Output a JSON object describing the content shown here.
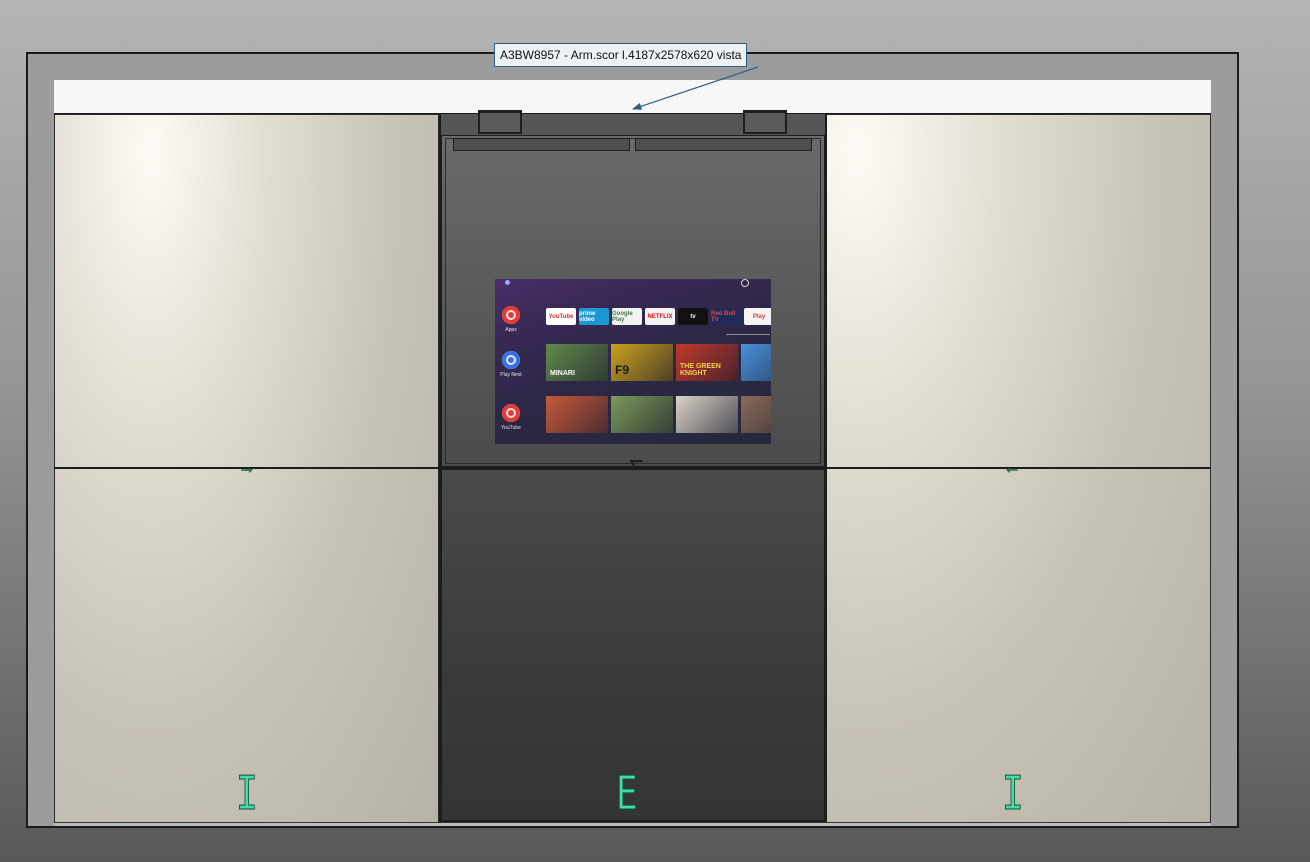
{
  "label": {
    "text": "A3BW8957 - Arm.scor  l.4187x2578x620 vista"
  },
  "openings": {
    "left_door": "I",
    "center_door": "E",
    "right_door": "I"
  },
  "arrows": {
    "left_door": "→",
    "right_door": "←"
  },
  "tv_screen": {
    "side_apps": [
      {
        "label": "Apps",
        "color": "#e53935"
      },
      {
        "label": "Play Next",
        "color": "#3b6fe0"
      },
      {
        "label": "YouTube",
        "color": "#e53935"
      }
    ],
    "app_row": [
      {
        "label": "YouTube",
        "bg": "#ffffff",
        "fg": "#d32f2f"
      },
      {
        "label": "prime video",
        "bg": "#1a98d5",
        "fg": "#ffffff"
      },
      {
        "label": "Google Play",
        "bg": "#f2f2f2",
        "fg": "#3a7d44"
      },
      {
        "label": "NETFLIX",
        "bg": "#f4f4f4",
        "fg": "#e50914"
      },
      {
        "label": "tv",
        "bg": "#111111",
        "fg": "#ffffff"
      },
      {
        "label": "Red Bull TV",
        "bg": "#1f2a5a",
        "fg": "#e8453c"
      },
      {
        "label": "Play",
        "bg": "#f4f4f4",
        "fg": "#e53935"
      }
    ],
    "play_next": [
      {
        "title": "MINARI",
        "bg": "#5f8a4a",
        "fg": "#ffffff"
      },
      {
        "title": "F9",
        "bg": "#caa21d",
        "fg": "#1a1a1a"
      },
      {
        "title": "THE GREEN KNIGHT",
        "bg": "#c0392b",
        "fg": "#f5d547"
      },
      {
        "title": "",
        "bg": "#4a90d9",
        "fg": "#ffffff"
      }
    ],
    "youtube": [
      {
        "title": "",
        "bg": "#c65a3a",
        "fg": "#ffffff"
      },
      {
        "title": "",
        "bg": "#7a9a5a",
        "fg": "#ffffff"
      },
      {
        "title": "",
        "bg": "#d9d3c8",
        "fg": "#333333"
      },
      {
        "title": "",
        "bg": "#8a6a5a",
        "fg": "#ffffff"
      }
    ]
  }
}
